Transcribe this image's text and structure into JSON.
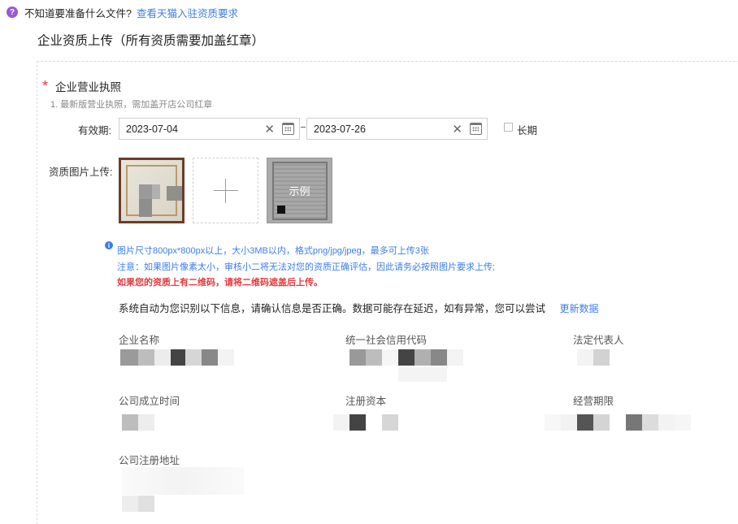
{
  "topbar": {
    "question": "不知道要准备什么文件?",
    "link": "查看天猫入驻资质要求"
  },
  "section_title": "企业资质上传（所有资质需要加盖红章）",
  "license": {
    "required_mark": "*",
    "title": "企业营业执照",
    "subtitle": "1. 最新版营业执照，需加盖开店公司红章",
    "validity_label": "有效期:",
    "start_date": "2023-07-04",
    "end_date": "2023-07-26",
    "long_term_label": "长期",
    "long_term_checked": false,
    "upload_label": "资质图片上传:",
    "sample_label": "示例"
  },
  "notes": {
    "size_tip": "图片尺寸800px*800px以上，大小3MB以内，格式png/jpg/jpeg，最多可上传3张",
    "quality_tip": "注意：如果图片像素太小，审核小二将无法对您的资质正确评估，因此请务必按照图片要求上传;",
    "qr_warning": "如果您的资质上有二维码，请将二维码遮盖后上传。"
  },
  "auto_recognition": {
    "text": "系统自动为您识别以下信息，请确认信息是否正确。数据可能存在延迟，如有异常，您可以尝试",
    "refresh_link": "更新数据"
  },
  "fields": {
    "company_name": "企业名称",
    "credit_code": "统一社会信用代码",
    "legal_rep": "法定代表人",
    "established": "公司成立时间",
    "capital": "注册资本",
    "term": "经营期限",
    "address": "公司注册地址"
  },
  "colors": {
    "link": "#3b7ee8",
    "required": "#e4393c",
    "help_icon": "#9b59d6"
  },
  "icons": {
    "help": "question-circle-icon",
    "clear": "close-icon",
    "calendar": "calendar-icon",
    "upload": "plus-icon",
    "info": "info-circle-icon"
  }
}
